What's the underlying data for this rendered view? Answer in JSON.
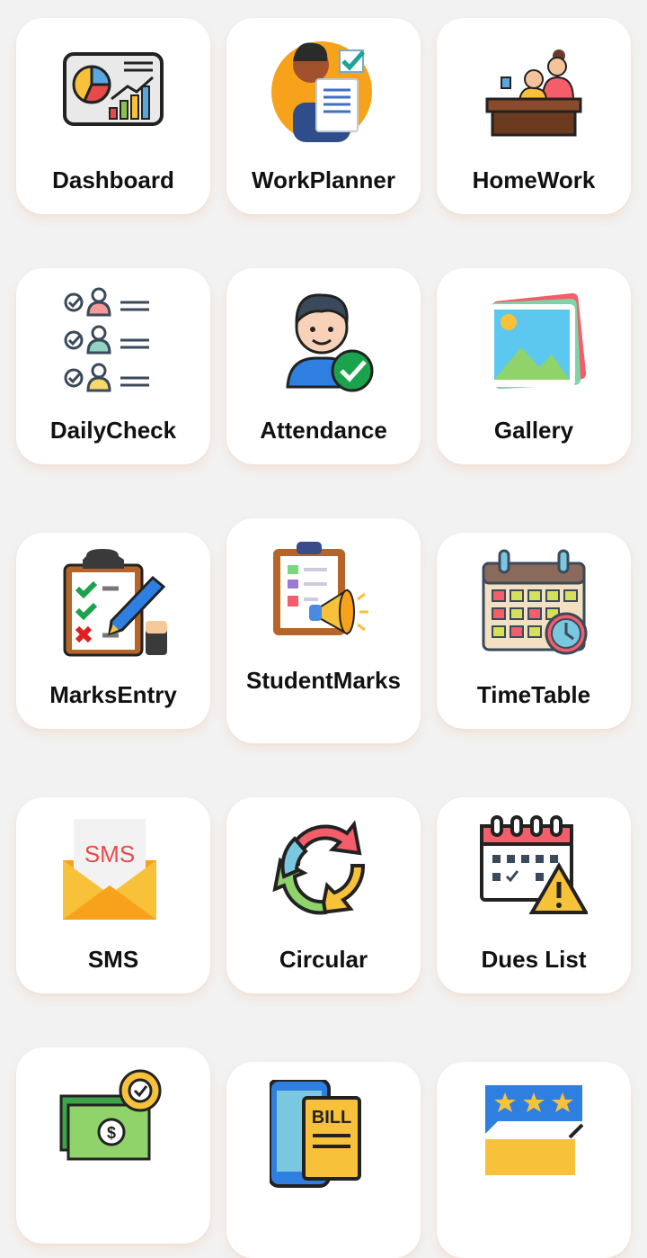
{
  "grid": {
    "items": [
      {
        "label": "Dashboard",
        "icon": "dashboard-chart-icon"
      },
      {
        "label": "WorkPlanner",
        "icon": "work-planner-icon"
      },
      {
        "label": "HomeWork",
        "icon": "homework-icon"
      },
      {
        "label": "DailyCheck",
        "icon": "daily-check-icon"
      },
      {
        "label": "Attendance",
        "icon": "attendance-icon"
      },
      {
        "label": "Gallery",
        "icon": "gallery-icon"
      },
      {
        "label": "MarksEntry",
        "icon": "marks-entry-icon"
      },
      {
        "label": "StudentMarks",
        "icon": "student-marks-icon"
      },
      {
        "label": "TimeTable",
        "icon": "timetable-icon"
      },
      {
        "label": "SMS",
        "icon": "sms-envelope-icon"
      },
      {
        "label": "Circular",
        "icon": "circular-arrows-icon"
      },
      {
        "label": "Dues List",
        "icon": "dues-calendar-warning-icon"
      },
      {
        "label": "",
        "icon": "fees-money-gear-icon"
      },
      {
        "label": "",
        "icon": "bill-phone-icon"
      },
      {
        "label": "",
        "icon": "rating-stars-icon"
      }
    ],
    "sms_icon_text": "SMS",
    "bill_icon_text": "BILL"
  }
}
